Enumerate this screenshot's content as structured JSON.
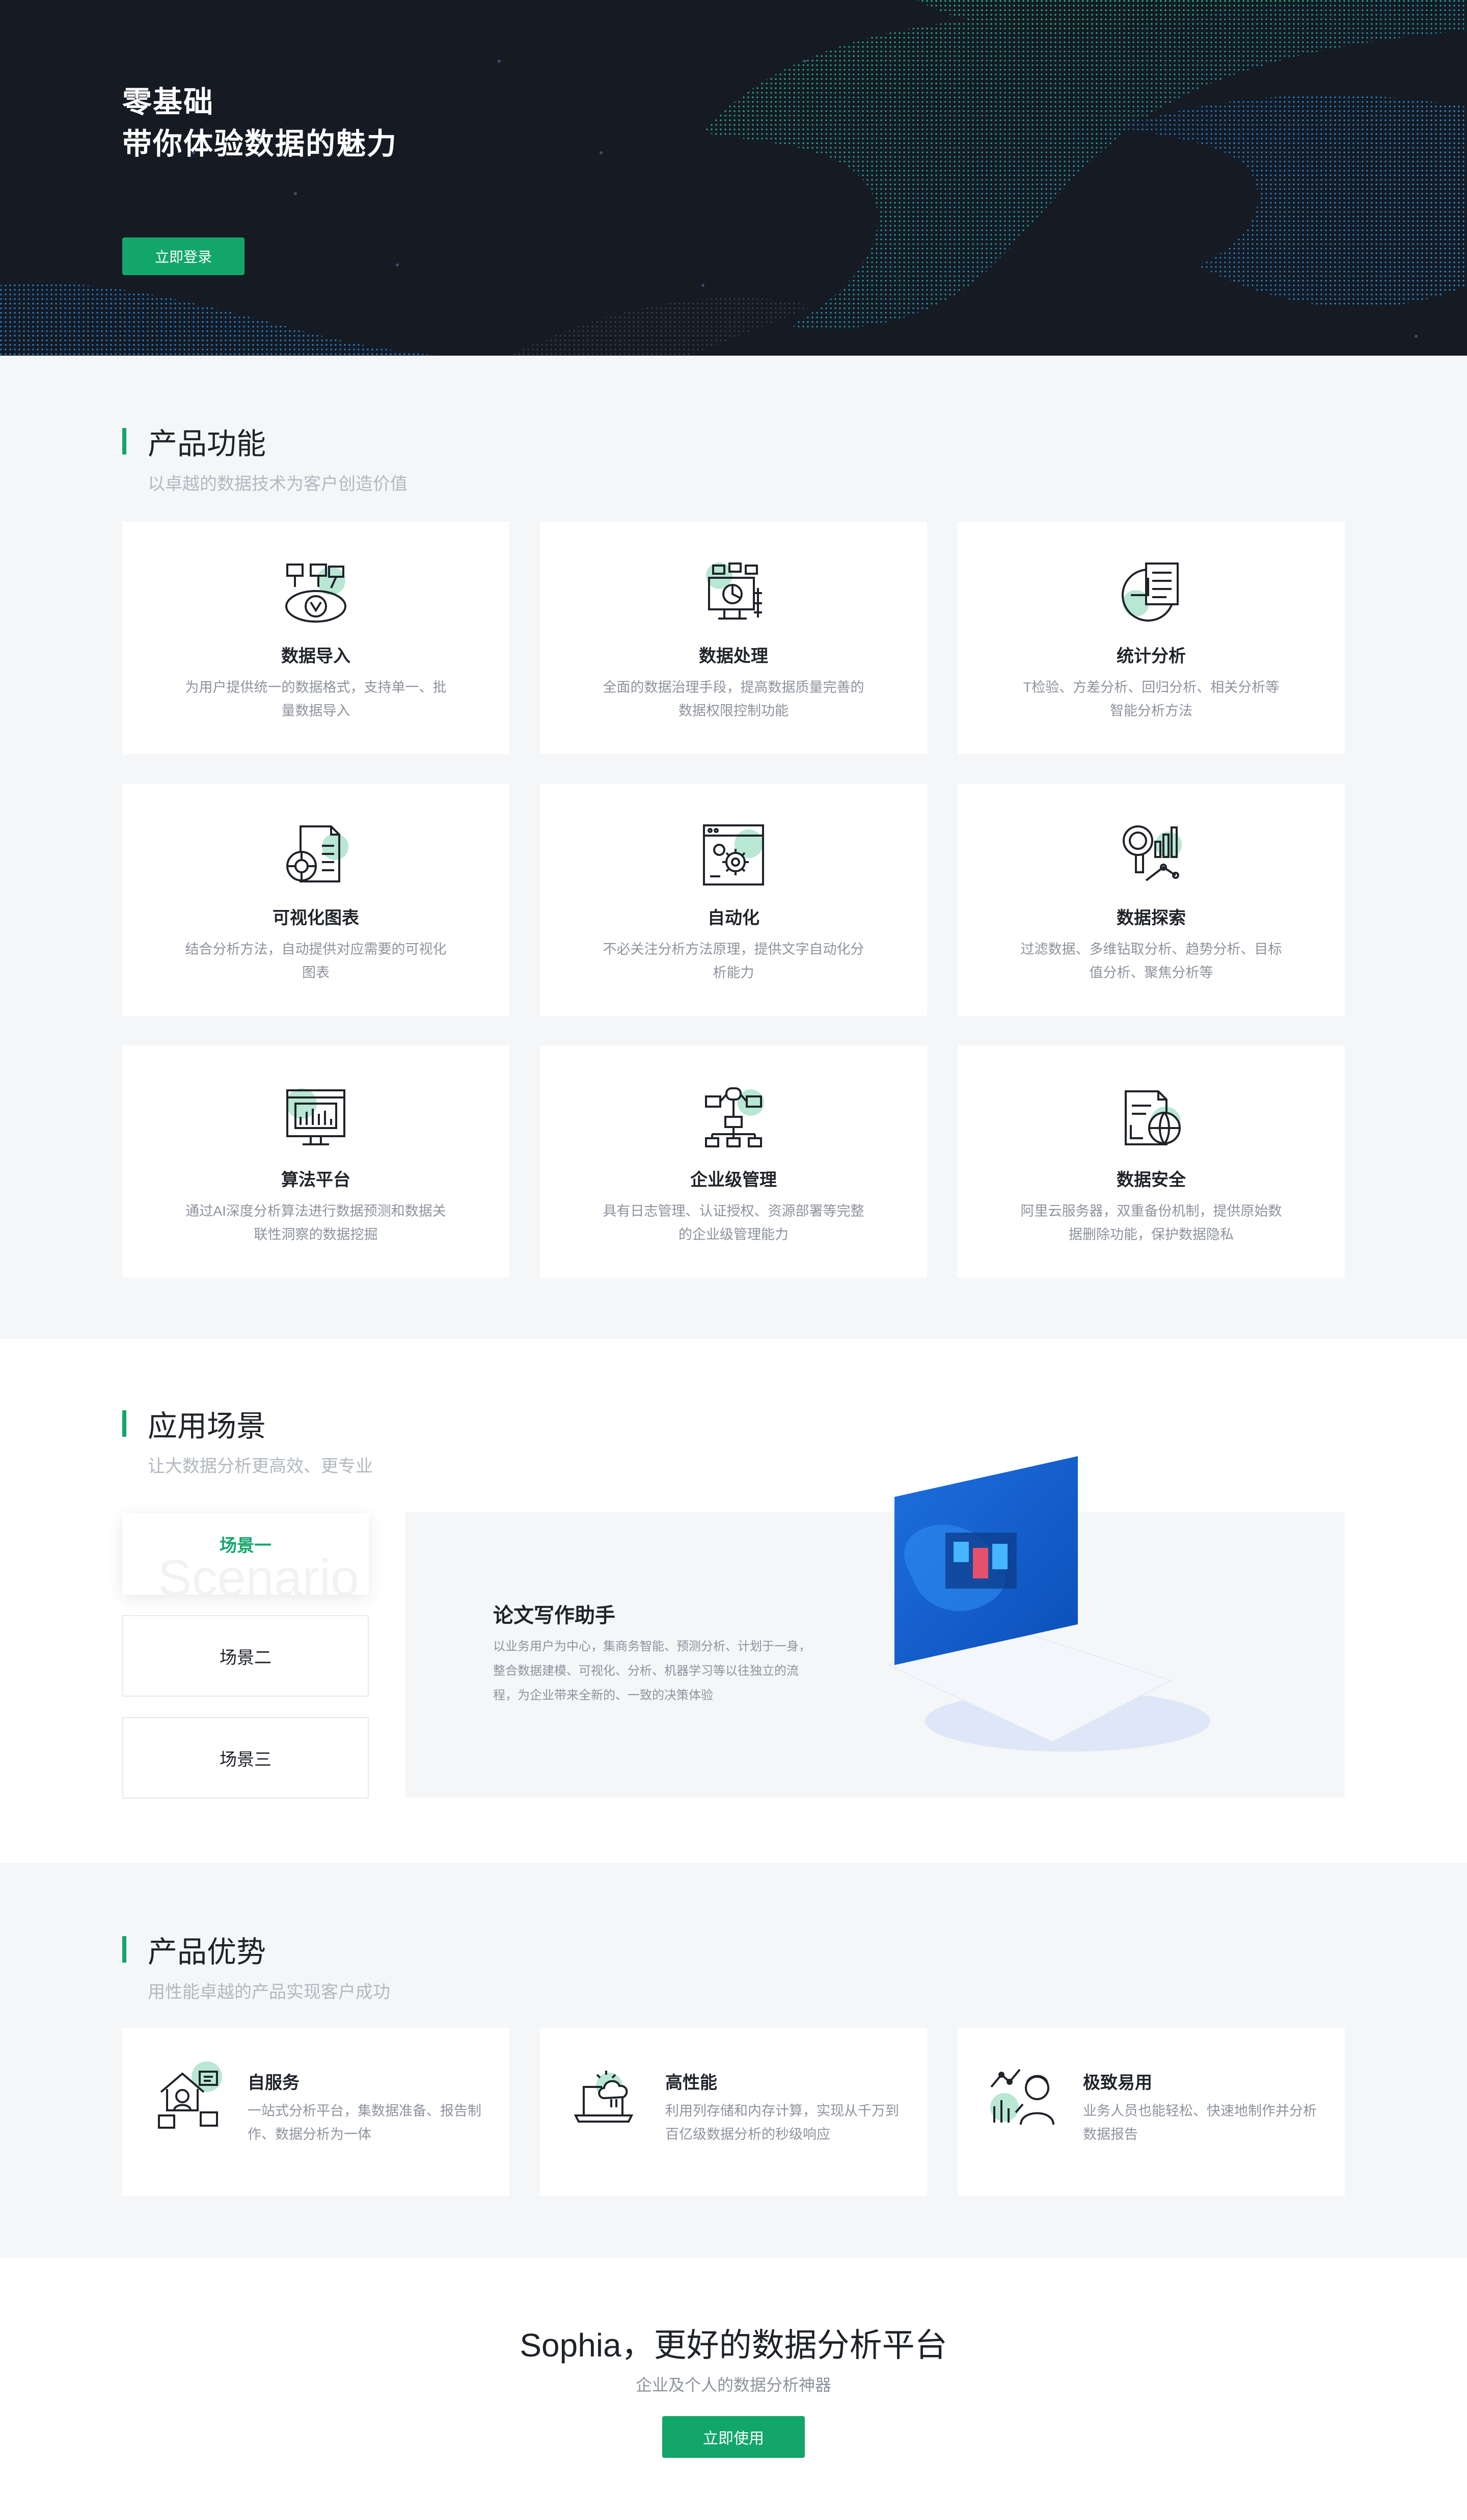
{
  "hero": {
    "title_line1": "零基础",
    "title_line2": "带你体验数据的魅力",
    "login_button": "立即登录"
  },
  "features": {
    "title": "产品功能",
    "subtitle": "以卓越的数据技术为客户创造价值",
    "items": [
      {
        "title": "数据导入",
        "desc": "为用户提供统一的数据格式，支持单一、批量数据导入",
        "icon": "data-import-icon"
      },
      {
        "title": "数据处理",
        "desc": "全面的数据治理手段，提高数据质量完善的数据权限控制功能",
        "icon": "data-processing-icon"
      },
      {
        "title": "统计分析",
        "desc": "T检验、方差分析、回归分析、相关分析等智能分析方法",
        "icon": "statistics-icon"
      },
      {
        "title": "可视化图表",
        "desc": "结合分析方法，自动提供对应需要的可视化图表",
        "icon": "chart-report-icon"
      },
      {
        "title": "自动化",
        "desc": "不必关注分析方法原理，提供文字自动化分析能力",
        "icon": "automation-gear-icon"
      },
      {
        "title": "数据探索",
        "desc": "过滤数据、多维钻取分析、趋势分析、目标值分析、聚焦分析等",
        "icon": "data-explore-icon"
      },
      {
        "title": "算法平台",
        "desc": "通过AI深度分析算法进行数据预测和数据关联性洞察的数据挖掘",
        "icon": "algorithm-monitor-icon"
      },
      {
        "title": "企业级管理",
        "desc": "具有日志管理、认证授权、资源部署等完整的企业级管理能力",
        "icon": "org-chart-icon"
      },
      {
        "title": "数据安全",
        "desc": "阿里云服务器，双重备份机制，提供原始数据删除功能，保护数据隐私",
        "icon": "data-security-icon"
      }
    ]
  },
  "scenes": {
    "title": "应用场景",
    "subtitle": "让大数据分析更高效、更专业",
    "tabs": [
      "场景一",
      "场景二",
      "场景三"
    ],
    "ghost_text": "Scenario",
    "panel_title": "论文写作助手",
    "panel_desc": "以业务用户为中心，集商务智能、预测分析、计划于一身，整合数据建模、可视化、分析、机器学习等以往独立的流程，为企业带来全新的、一致的决策体验"
  },
  "advantages": {
    "title": "产品优势",
    "subtitle": "用性能卓越的产品实现客户成功",
    "items": [
      {
        "title": "自服务",
        "desc": "一站式分析平台，集数据准备、报告制作、数据分析为一体",
        "icon": "self-service-house-icon"
      },
      {
        "title": "高性能",
        "desc": "利用列存储和内存计算，实现从千万到百亿级数据分析的秒级响应",
        "icon": "cloud-laptop-icon"
      },
      {
        "title": "极致易用",
        "desc": "业务人员也能轻松、快速地制作并分析数据报告",
        "icon": "easy-user-icon"
      }
    ]
  },
  "cta": {
    "title": "Sophia，更好的数据分析平台",
    "subtitle": "企业及个人的数据分析神器",
    "button": "立即使用"
  },
  "colors": {
    "brand_green": "#12a66a",
    "hero_bg": "#151a23",
    "section_bg": "#f5f6f8",
    "wave_teal": "#21c28e",
    "wave_blue": "#1d8fe6"
  }
}
